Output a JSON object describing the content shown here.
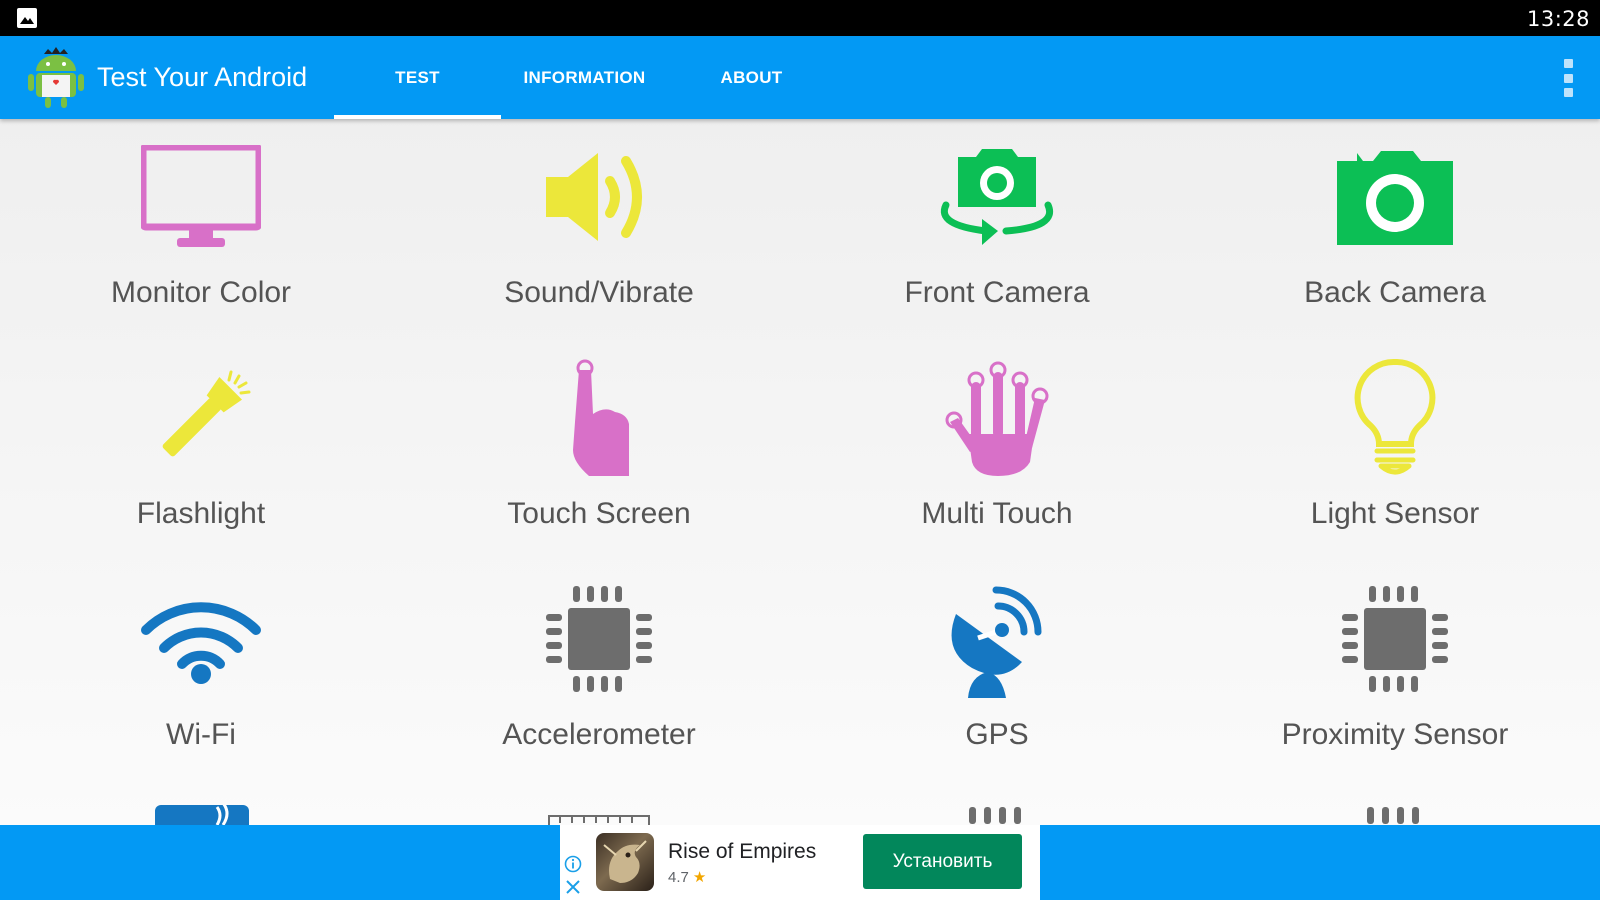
{
  "status_bar": {
    "time": "13:28",
    "notification_icon": "image-icon"
  },
  "app_bar": {
    "title": "Test Your Android",
    "tabs": [
      {
        "label": "TEST",
        "active": true
      },
      {
        "label": "INFORMATION",
        "active": false
      },
      {
        "label": "ABOUT",
        "active": false
      }
    ],
    "menu_icon": "overflow-menu-icon"
  },
  "tests": [
    {
      "label": "Monitor Color",
      "icon": "monitor-icon",
      "color": "#d870c8"
    },
    {
      "label": "Sound/Vibrate",
      "icon": "speaker-icon",
      "color": "#ece73a"
    },
    {
      "label": "Front Camera",
      "icon": "front-camera-icon",
      "color": "#0cbf55"
    },
    {
      "label": "Back Camera",
      "icon": "back-camera-icon",
      "color": "#0cbf55"
    },
    {
      "label": "Flashlight",
      "icon": "flashlight-icon",
      "color": "#ece73a"
    },
    {
      "label": "Touch Screen",
      "icon": "touch-finger-icon",
      "color": "#d870c8"
    },
    {
      "label": "Multi Touch",
      "icon": "multi-touch-hand-icon",
      "color": "#d870c8"
    },
    {
      "label": "Light Sensor",
      "icon": "light-bulb-icon",
      "color": "#ece73a"
    },
    {
      "label": "Wi-Fi",
      "icon": "wifi-icon",
      "color": "#1577c2"
    },
    {
      "label": "Accelerometer",
      "icon": "chip-icon",
      "color": "#6d6d6d"
    },
    {
      "label": "GPS",
      "icon": "satellite-dish-icon",
      "color": "#1577c2"
    },
    {
      "label": "Proximity Sensor",
      "icon": "chip-icon",
      "color": "#6d6d6d"
    }
  ],
  "ad": {
    "app_name": "Rise of Empires",
    "rating": "4.7",
    "install_label": "Установить",
    "info_icon": "info-icon",
    "close_icon": "close-icon"
  },
  "colors": {
    "primary": "#0399f4",
    "label_text": "#545454",
    "install_button": "#02875b"
  }
}
